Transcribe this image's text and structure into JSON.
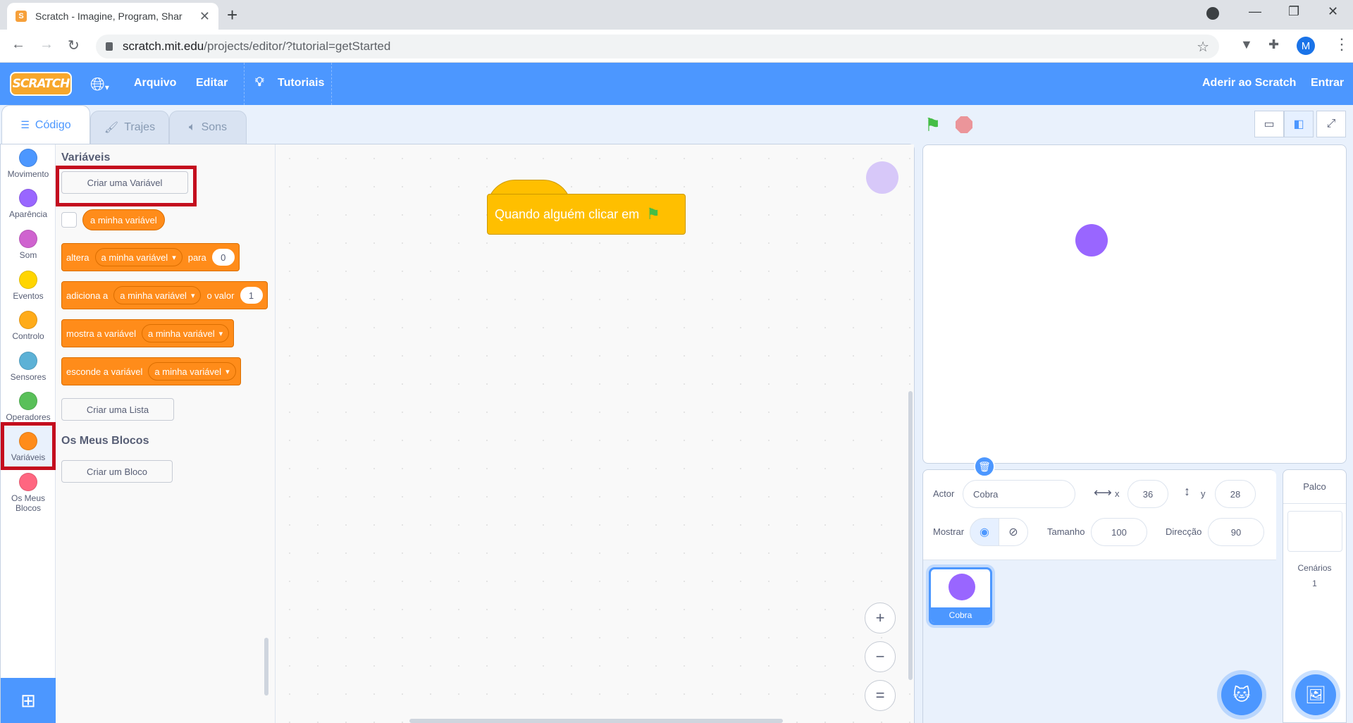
{
  "browser": {
    "tab_title": "Scratch - Imagine, Program, Shar",
    "favicon": "S",
    "url_host": "scratch.mit.edu",
    "url_path": "/projects/editor/?tutorial=getStarted",
    "avatar": "M"
  },
  "menubar": {
    "logo": "SCRATCH",
    "file": "Arquivo",
    "edit": "Editar",
    "tutorials": "Tutoriais",
    "join": "Aderir ao Scratch",
    "signin": "Entrar"
  },
  "editor_tabs": {
    "code": "Código",
    "costumes": "Trajes",
    "sounds": "Sons"
  },
  "categories": [
    {
      "label": "Movimento",
      "color": "#4c97ff"
    },
    {
      "label": "Aparência",
      "color": "#9966ff"
    },
    {
      "label": "Som",
      "color": "#cf63cf"
    },
    {
      "label": "Eventos",
      "color": "#ffd500"
    },
    {
      "label": "Controlo",
      "color": "#ffab19"
    },
    {
      "label": "Sensores",
      "color": "#5cb1d6"
    },
    {
      "label": "Operadores",
      "color": "#59c059"
    },
    {
      "label": "Variáveis",
      "color": "#ff8c1a"
    },
    {
      "label": "Os Meus Blocos",
      "color": "#ff6680"
    }
  ],
  "palette": {
    "variables_heading": "Variáveis",
    "create_variable": "Criar uma Variável",
    "variable_name": "a minha variável",
    "set_block": {
      "prefix": "altera",
      "var": "a minha variável",
      "mid": "para",
      "value": "0"
    },
    "change_block": {
      "prefix": "adiciona a",
      "var": "a minha variável",
      "mid": "o valor",
      "value": "1"
    },
    "show_block": {
      "prefix": "mostra a variável",
      "var": "a minha variável"
    },
    "hide_block": {
      "prefix": "esconde a variável",
      "var": "a minha variável"
    },
    "create_list": "Criar uma Lista",
    "my_blocks_heading": "Os Meus Blocos",
    "create_block": "Criar um Bloco"
  },
  "script": {
    "hat_text": "Quando alguém clicar em"
  },
  "zoom": {
    "in": "+",
    "out": "−",
    "reset": "="
  },
  "sprite_info": {
    "sprite_label": "Actor",
    "sprite_name": "Cobra",
    "x_label": "x",
    "x_value": "36",
    "y_label": "y",
    "y_value": "28",
    "show_label": "Mostrar",
    "size_label": "Tamanho",
    "size_value": "100",
    "direction_label": "Direcção",
    "direction_value": "90"
  },
  "sprites": [
    {
      "name": "Cobra"
    }
  ],
  "stage_pane": {
    "title": "Palco",
    "backdrops_label": "Cenários",
    "backdrops_count": "1"
  },
  "colors": {
    "scratch_blue": "#4c97ff",
    "variables_orange": "#ff8c1a",
    "events_yellow": "#ffbf00",
    "highlight_red": "#c40d1e",
    "sprite_purple": "#9966ff"
  }
}
